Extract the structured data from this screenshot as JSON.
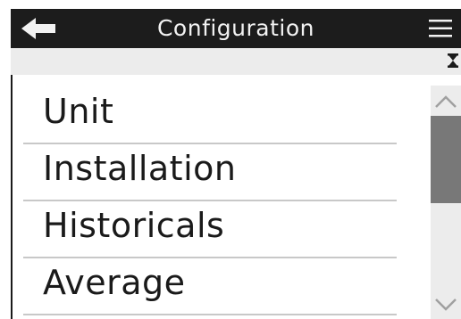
{
  "header": {
    "title": "Configuration",
    "back_icon": "arrow-left-icon",
    "menu_icon": "hamburger-menu-icon"
  },
  "status_bar": {
    "icon": "hourglass-icon"
  },
  "menu": {
    "items": [
      {
        "label": "Unit"
      },
      {
        "label": "Installation"
      },
      {
        "label": "Historicals"
      },
      {
        "label": "Average"
      }
    ]
  },
  "scrollbar": {
    "up_icon": "chevron-up-icon",
    "down_icon": "chevron-down-icon",
    "position": 0
  },
  "colors": {
    "header_bg": "#1c1c1c",
    "header_text": "#f2f2f2",
    "status_bg": "#ececec",
    "divider": "#c8c8c8",
    "scroll_thumb": "#787878"
  }
}
